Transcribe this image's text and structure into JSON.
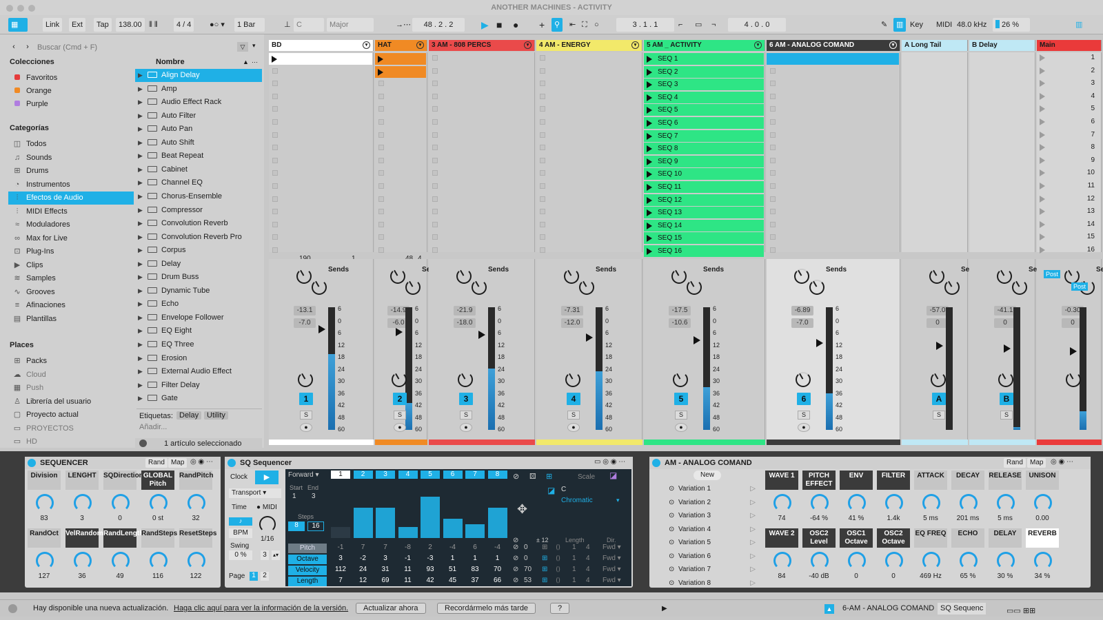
{
  "app": {
    "title": "ANOTHER MACHINES - ACTIVITY"
  },
  "toolbar": {
    "link": "Link",
    "ext": "Ext",
    "tap": "Tap",
    "tempo": "138.00",
    "signature": "4 / 4",
    "quantize": "1 Bar",
    "key": "C",
    "scale": "Major",
    "position": "48 .   2 .   2",
    "loop_start": "3 .   1 .   1",
    "loop_len": "4 .   0 .   0",
    "key_btn": "Key",
    "midi_btn": "MIDI",
    "sample_rate": "48.0 kHz",
    "cpu": "26 %"
  },
  "browser": {
    "search_placeholder": "Buscar (Cmd + F)",
    "name_header": "Nombre",
    "collections_title": "Colecciones",
    "collections": [
      {
        "label": "Favoritos",
        "color": "#e53b3b"
      },
      {
        "label": "Orange",
        "color": "#f08a24"
      },
      {
        "label": "Purple",
        "color": "#b07de0"
      }
    ],
    "categories_title": "Categorías",
    "categories": [
      {
        "label": "Todos",
        "icon": "◫"
      },
      {
        "label": "Sounds",
        "icon": "♫"
      },
      {
        "label": "Drums",
        "icon": "⊞"
      },
      {
        "label": "Instrumentos",
        "icon": "◔"
      },
      {
        "label": "Efectos de Audio",
        "icon": "⫶"
      },
      {
        "label": "MIDI Effects",
        "icon": "⫶"
      },
      {
        "label": "Moduladores",
        "icon": "≈"
      },
      {
        "label": "Max for Live",
        "icon": "∞"
      },
      {
        "label": "Plug-Ins",
        "icon": "⊡"
      },
      {
        "label": "Clips",
        "icon": "▶"
      },
      {
        "label": "Samples",
        "icon": "≋"
      },
      {
        "label": "Grooves",
        "icon": "∿"
      },
      {
        "label": "Afinaciones",
        "icon": "≡"
      },
      {
        "label": "Plantillas",
        "icon": "▤"
      }
    ],
    "places_title": "Places",
    "places": [
      {
        "label": "Packs",
        "icon": "⊞"
      },
      {
        "label": "Cloud",
        "icon": "☁"
      },
      {
        "label": "Push",
        "icon": "▦"
      },
      {
        "label": "Librería del usuario",
        "icon": "♙"
      },
      {
        "label": "Proyecto actual",
        "icon": "▢"
      },
      {
        "label": "PROYECTOS",
        "icon": "▭"
      },
      {
        "label": "HD",
        "icon": "▭"
      }
    ],
    "contents": [
      "Align Delay",
      "Amp",
      "Audio Effect Rack",
      "Auto Filter",
      "Auto Pan",
      "Auto Shift",
      "Beat Repeat",
      "Cabinet",
      "Channel EQ",
      "Chorus-Ensemble",
      "Compressor",
      "Convolution Reverb",
      "Convolution Reverb Pro",
      "Corpus",
      "Delay",
      "Drum Buss",
      "Dynamic Tube",
      "Echo",
      "Envelope Follower",
      "EQ Eight",
      "EQ Three",
      "Erosion",
      "External Audio Effect",
      "Filter Delay",
      "Gate"
    ],
    "tags_label": "Etiquetas:",
    "tags": [
      "Delay",
      "Utility"
    ],
    "add_label": "Añadir...",
    "selection": "1 artículo seleccionado"
  },
  "tracks": [
    {
      "name": "BD",
      "color": "#ffffff",
      "vol": "-13.1",
      "pan": "-7.0",
      "num": "1",
      "bottom": "190",
      "bottom2": "1",
      "fill": 0.62
    },
    {
      "name": "HAT",
      "color": "#f08a24",
      "vol": "-14.9",
      "pan": "-6.0",
      "num": "2",
      "bottom": "48",
      "bottom2": "4",
      "fill": 0.22
    },
    {
      "name": "3 AM - 808 PERCS",
      "color": "#ea4a4a",
      "vol": "-21.9",
      "pan": "-18.0",
      "num": "3",
      "bottom": "",
      "bottom2": "",
      "fill": 0.5
    },
    {
      "name": "4 AM - ENERGY",
      "color": "#f2e96a",
      "vol": "-7.31",
      "pan": "-12.0",
      "num": "4",
      "bottom": "",
      "bottom2": "",
      "fill": 0.48
    },
    {
      "name": "5 AM _ ACTIVITY",
      "color": "#2ee585",
      "vol": "-17.5",
      "pan": "-10.6",
      "num": "5",
      "bottom": "",
      "bottom2": "",
      "fill": 0.35
    },
    {
      "name": "6 AM - ANALOG COMAND",
      "color": "#3b3b3b",
      "vol": "-6.89",
      "pan": "-7.0",
      "num": "6",
      "bottom": "",
      "bottom2": "",
      "fill": 0.3
    },
    {
      "name": "A Long Tail",
      "color": "#bfe8f5",
      "vol": "-57.0",
      "pan": "0",
      "num": "A",
      "bottom": "",
      "bottom2": "",
      "fill": 0.0
    },
    {
      "name": "B Delay",
      "color": "#bfe8f5",
      "vol": "-41.1",
      "pan": "0",
      "num": "B",
      "bottom": "",
      "bottom2": "",
      "fill": 0.02
    },
    {
      "name": "Main",
      "color": "#ea3a3a",
      "vol": "-0.30",
      "pan": "0",
      "num": "",
      "bottom": "",
      "bottom2": "",
      "fill": 0.15
    }
  ],
  "scenes": [
    "1",
    "2",
    "3",
    "4",
    "5",
    "6",
    "7",
    "8",
    "9",
    "10",
    "11",
    "12",
    "13",
    "14",
    "15",
    "16"
  ],
  "seq_clips": [
    "SEQ 1",
    "SEQ 2",
    "SEQ 3",
    "SEQ 4",
    "SEQ 5",
    "SEQ 6",
    "SEQ 7",
    "SEQ 8",
    "SEQ 9",
    "SEQ 10",
    "SEQ 11",
    "SEQ 12",
    "SEQ 13",
    "SEQ 14",
    "SEQ 15",
    "SEQ 16"
  ],
  "mixer": {
    "sends": "Sends",
    "post": "Post",
    "scale": [
      "6",
      "0",
      "6",
      "12",
      "18",
      "24",
      "30",
      "36",
      "42",
      "48",
      "60"
    ],
    "solo": "S"
  },
  "sequencer_rack": {
    "title": "SEQUENCER",
    "rand": "Rand",
    "map": "Map",
    "row1": [
      {
        "label": "Division",
        "value": "83",
        "style": "lt"
      },
      {
        "label": "LENGHT",
        "value": "3",
        "style": "lt"
      },
      {
        "label": "SQDirection",
        "value": "0",
        "style": "lt"
      },
      {
        "label": "GLOBAL Pitch",
        "value": "0 st",
        "style": "dk"
      },
      {
        "label": "RandPitch",
        "value": "32",
        "style": "lt"
      }
    ],
    "row2": [
      {
        "label": "RandOct",
        "value": "127",
        "style": "lt"
      },
      {
        "label": "VelRandom",
        "value": "36",
        "style": "dk"
      },
      {
        "label": "RandLength",
        "value": "49",
        "style": "dk"
      },
      {
        "label": "RandSteps",
        "value": "116",
        "style": "lt"
      },
      {
        "label": "ResetSteps",
        "value": "122",
        "style": "lt"
      }
    ]
  },
  "sq_sequencer": {
    "title": "SQ Sequencer",
    "clock": "Clock",
    "transport": "Transport",
    "time": "Time",
    "midi": "MIDI",
    "bpm": "BPM",
    "division": "1/16",
    "swing_label": "Swing",
    "swing": "0 %",
    "swing_steps": "3",
    "page_label": "Page",
    "pages": [
      "1",
      "2"
    ],
    "direction": "Forward",
    "start_label": "Start",
    "end_label": "End",
    "start": "1",
    "end": "3",
    "steps_label": "Steps",
    "steps_a": "8",
    "steps_b": "16",
    "steps": [
      "1",
      "2",
      "3",
      "4",
      "5",
      "6",
      "7",
      "8"
    ],
    "bars": [
      0.2,
      0.55,
      0.55,
      0.2,
      0.75,
      0.35,
      0.25,
      0.55
    ],
    "rows": [
      {
        "label": "Pitch",
        "values": [
          "-1",
          "7",
          "7",
          "-8",
          "2",
          "-4",
          "6",
          "-4"
        ],
        "v2": "0"
      },
      {
        "label": "Octave",
        "values": [
          "3",
          "-2",
          "3",
          "-1",
          "-3",
          "1",
          "1",
          "1"
        ],
        "v2": "0"
      },
      {
        "label": "Velocity",
        "values": [
          "112",
          "24",
          "31",
          "11",
          "93",
          "51",
          "83",
          "70"
        ],
        "v2": "70"
      },
      {
        "label": "Length",
        "values": [
          "7",
          "12",
          "69",
          "11",
          "42",
          "45",
          "37",
          "66"
        ],
        "v2": "53"
      }
    ],
    "scale_label": "Scale",
    "scale_root": "C",
    "scale_name": "Chromatic",
    "transpose": "± 12",
    "length_label": "Length",
    "dir_label": "Dir.",
    "row_lengths": [
      "1",
      "1",
      "1",
      "1"
    ],
    "row_ends": [
      "4",
      "4",
      "4",
      "4"
    ],
    "row_dirs": [
      "Fwd",
      "Fwd",
      "Fwd",
      "Fwd"
    ]
  },
  "analog_rack": {
    "title": "AM - ANALOG COMAND",
    "new": "New",
    "rand": "Rand",
    "map": "Map",
    "variations": [
      "Variation 1",
      "Variation 2",
      "Variation 3",
      "Variation 4",
      "Variation 5",
      "Variation 6",
      "Variation 7",
      "Variation 8"
    ],
    "row1": [
      {
        "label": "WAVE 1",
        "value": "74",
        "style": "dk"
      },
      {
        "label": "PITCH EFFECT",
        "value": "-64 %",
        "style": "dk"
      },
      {
        "label": "ENV",
        "value": "41 %",
        "style": "dk"
      },
      {
        "label": "FILTER",
        "value": "1.4k",
        "style": "dk"
      },
      {
        "label": "ATTACK",
        "value": "5 ms",
        "style": "lt"
      },
      {
        "label": "DECAY",
        "value": "201 ms",
        "style": "lt"
      },
      {
        "label": "RELEASE",
        "value": "5 ms",
        "style": "lt"
      },
      {
        "label": "UNISON",
        "value": "0.00",
        "style": "lt"
      }
    ],
    "row2": [
      {
        "label": "WAVE 2",
        "value": "84",
        "style": "dk"
      },
      {
        "label": "OSC2 Level",
        "value": "-40 dB",
        "style": "dk"
      },
      {
        "label": "OSC1 Octave",
        "value": "0",
        "style": "dk"
      },
      {
        "label": "OSC2 Octave",
        "value": "0",
        "style": "dk"
      },
      {
        "label": "EQ FREQ",
        "value": "469 Hz",
        "style": "lt"
      },
      {
        "label": "ECHO",
        "value": "65 %",
        "style": "lt"
      },
      {
        "label": "DELAY",
        "value": "30 %",
        "style": "lt"
      },
      {
        "label": "REVERB",
        "value": "34 %",
        "style": "wh"
      }
    ]
  },
  "status": {
    "message": "Hay disponible una nueva actualización.",
    "link": "Haga clic aquí para ver la información de la versión.",
    "update_now": "Actualizar ahora",
    "remind_later": "Recordármelo más tarde",
    "help": "?",
    "track": "6-AM - ANALOG COMAND",
    "device": "SQ Sequenc"
  },
  "colors": {
    "accent": "#1fb0e6",
    "seq_green": "#2ee585",
    "orange": "#f08a24"
  }
}
